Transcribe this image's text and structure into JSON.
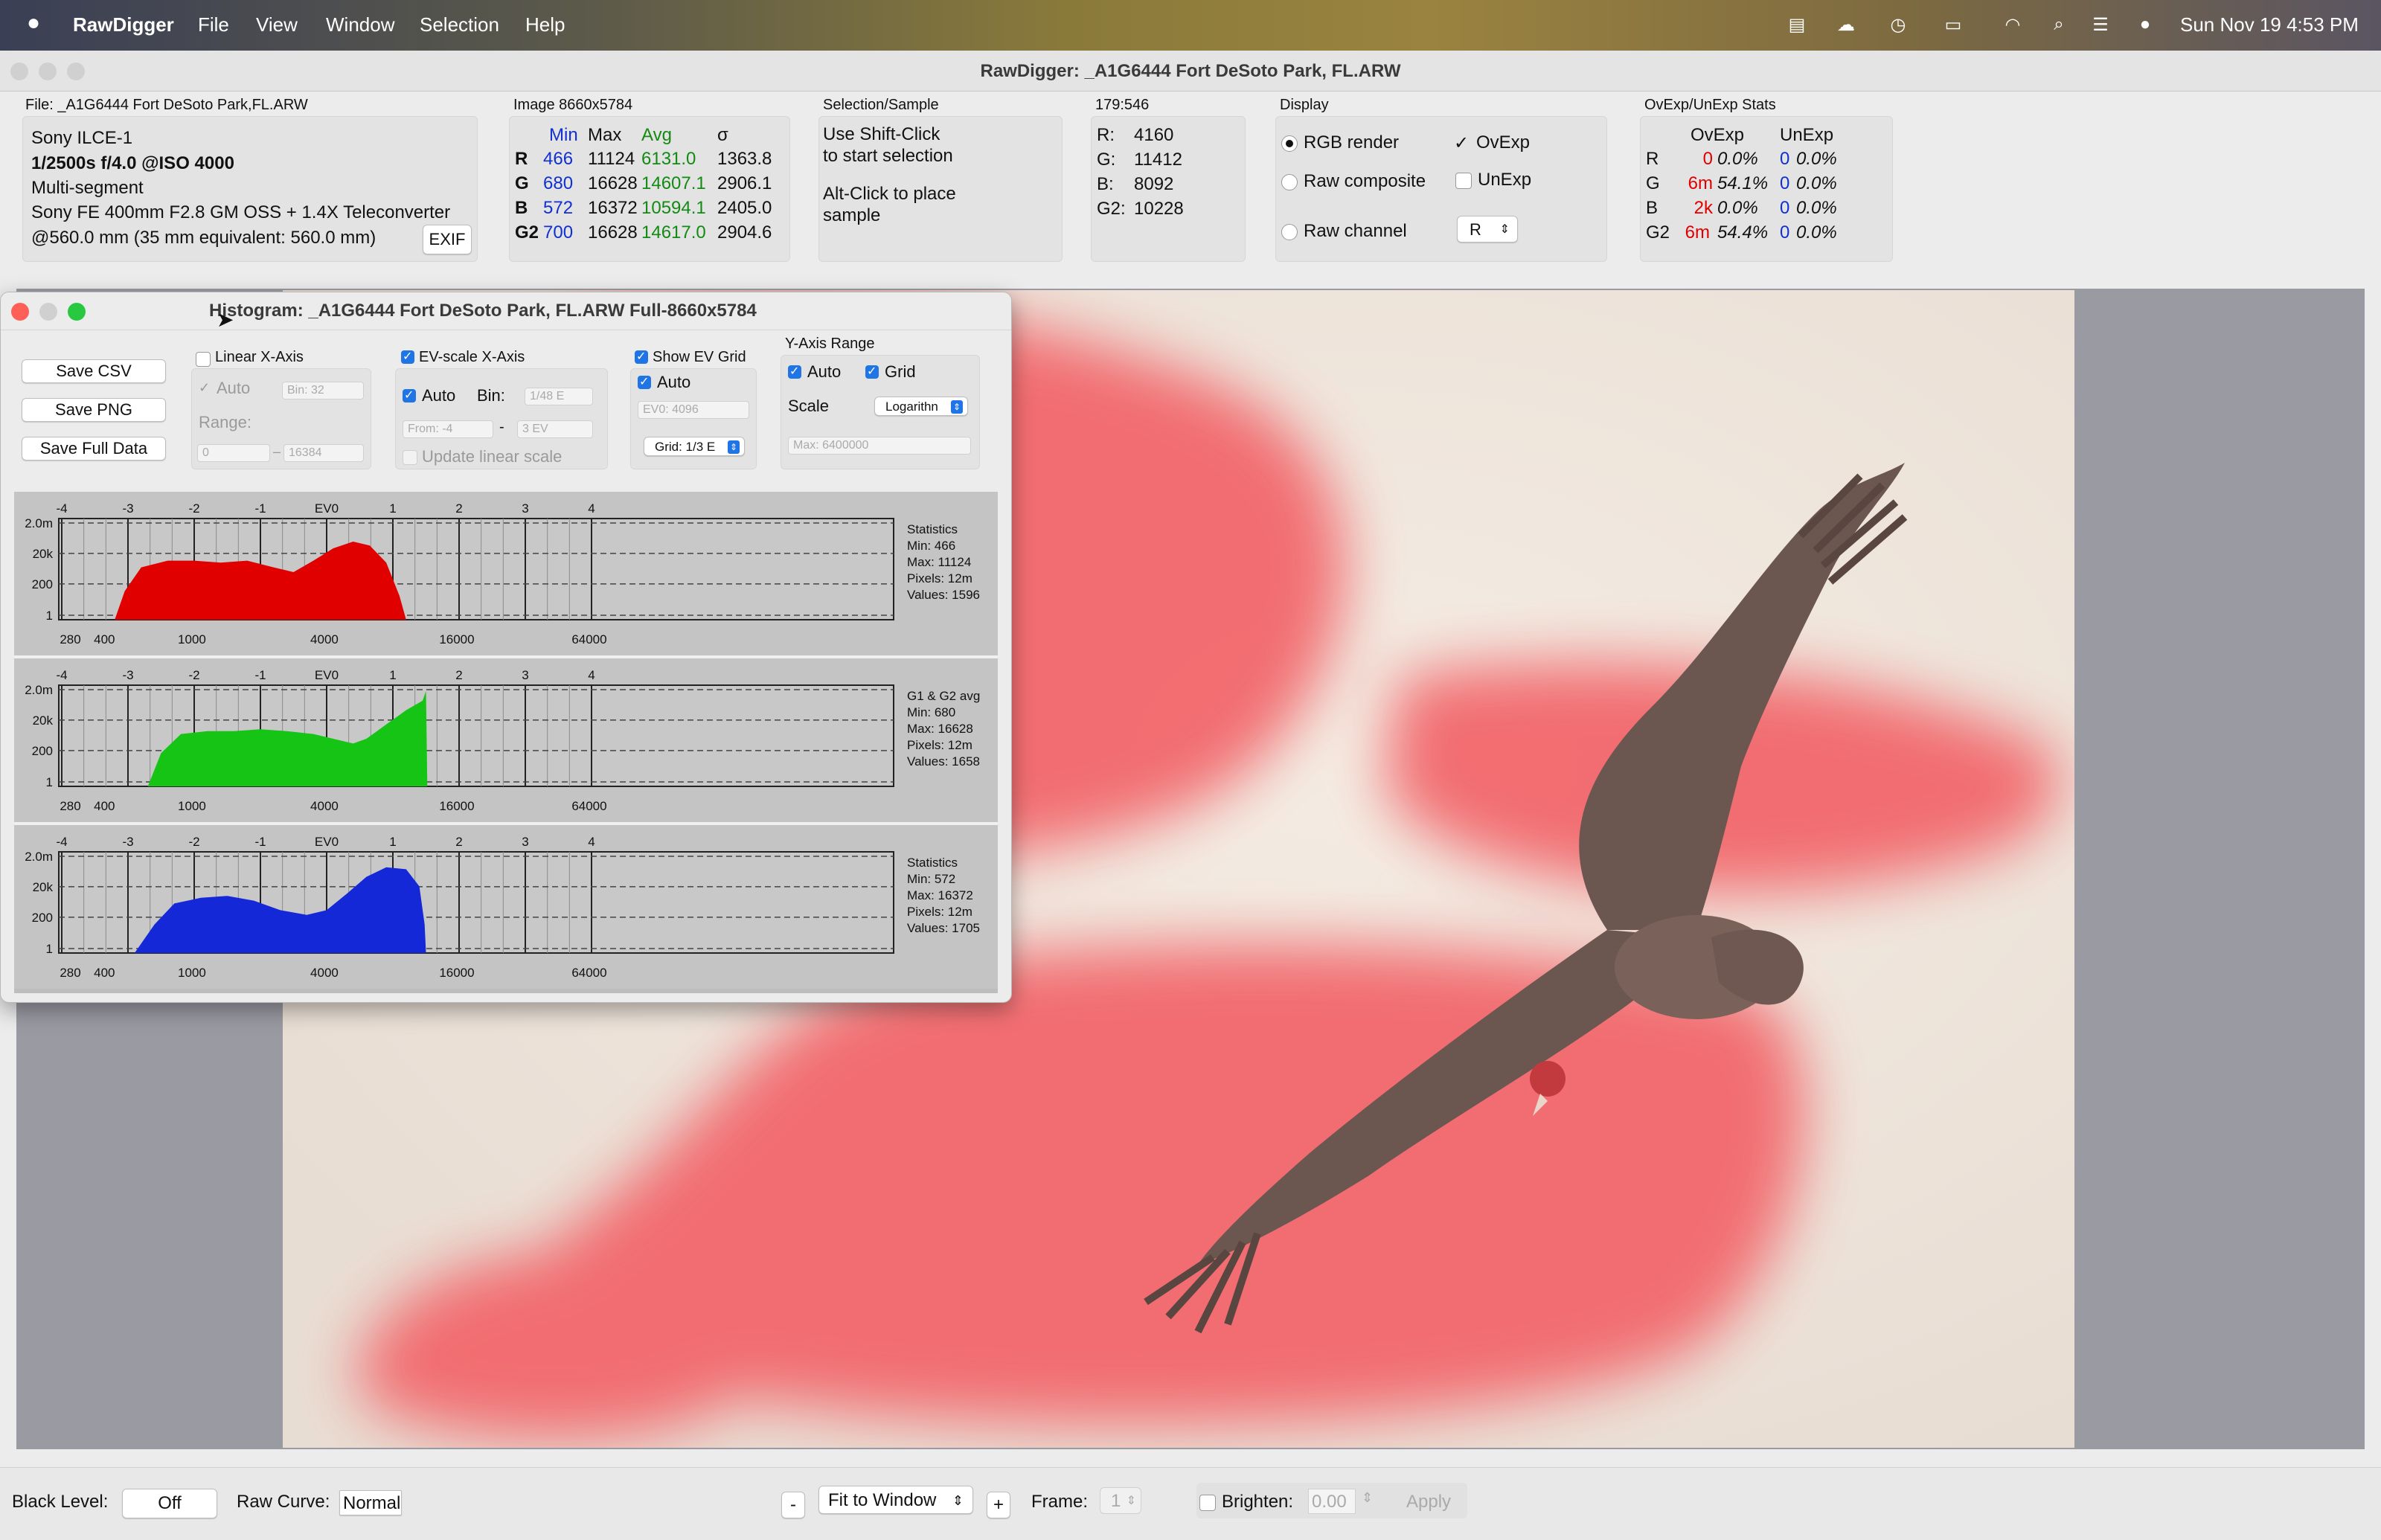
{
  "menubar": {
    "app": "RawDigger",
    "items": [
      "File",
      "View",
      "Window",
      "Selection",
      "Help"
    ],
    "datetime": "Sun Nov 19  4:53 PM"
  },
  "window": {
    "title": "RawDigger: _A1G6444  Fort DeSoto Park, FL.ARW"
  },
  "file_panel": {
    "label": "File: _A1G6444   Fort DeSoto Park,FL.ARW",
    "camera": "Sony ILCE-1",
    "exposure": "1/2500s f/4.0 @ISO 4000",
    "metering": "Multi-segment",
    "lens": "Sony FE 400mm F2.8 GM OSS + 1.4X Teleconverter",
    "focal": "@560.0 mm (35 mm equivalent: 560.0 mm)",
    "exif_button": "EXIF"
  },
  "image_panel": {
    "label": "Image 8660x5784",
    "headers": [
      "Min",
      "Max",
      "Avg",
      "σ"
    ],
    "rows": [
      {
        "ch": "R",
        "min": "466",
        "max": "11124",
        "avg": "6131.0",
        "sd": "1363.8"
      },
      {
        "ch": "G",
        "min": "680",
        "max": "16628",
        "avg": "14607.1",
        "sd": "2906.1"
      },
      {
        "ch": "B",
        "min": "572",
        "max": "16372",
        "avg": "10594.1",
        "sd": "2405.0"
      },
      {
        "ch": "G2",
        "min": "700",
        "max": "16628",
        "avg": "14617.0",
        "sd": "2904.6"
      }
    ]
  },
  "selection_panel": {
    "label": "Selection/Sample",
    "line1": "Use Shift-Click",
    "line2": "to start selection",
    "line3": "Alt-Click to place",
    "line4": "sample"
  },
  "coord_panel": {
    "label": "179:546",
    "rows": [
      {
        "ch": "R:",
        "v": "4160"
      },
      {
        "ch": "G:",
        "v": "11412"
      },
      {
        "ch": "B:",
        "v": "8092"
      },
      {
        "ch": "G2:",
        "v": "10228"
      }
    ]
  },
  "display_panel": {
    "label": "Display",
    "rgb": "RGB render",
    "raw_composite": "Raw composite",
    "raw_channel": "Raw channel",
    "ovexp": "OvExp",
    "unexp": "UnExp",
    "channel_select": "R"
  },
  "stats_panel": {
    "label": "OvExp/UnExp Stats",
    "headers": [
      "OvExp",
      "UnExp"
    ],
    "rows": [
      {
        "ch": "R",
        "ov": "0",
        "ovp": "0.0%",
        "un": "0",
        "unp": "0.0%"
      },
      {
        "ch": "G",
        "ov": "6m",
        "ovp": "54.1%",
        "un": "0",
        "unp": "0.0%"
      },
      {
        "ch": "B",
        "ov": "2k",
        "ovp": "0.0%",
        "un": "0",
        "unp": "0.0%"
      },
      {
        "ch": "G2",
        "ov": "6m",
        "ovp": "54.4%",
        "un": "0",
        "unp": "0.0%"
      }
    ]
  },
  "histogram": {
    "title": "Histogram: _A1G6444   Fort DeSoto Park, FL.ARW Full-8660x5784",
    "buttons": [
      "Save CSV",
      "Save PNG",
      "Save Full Data"
    ],
    "linear": {
      "label": "Linear X-Axis",
      "auto": "Auto",
      "bin": "Bin: 32",
      "range": "Range:",
      "from": "0",
      "to": "16384"
    },
    "ev": {
      "label": "EV-scale X-Axis",
      "auto": "Auto",
      "bin_label": "Bin:",
      "bin": "1/48 E",
      "from": "From: -4",
      "to": "3 EV",
      "update": "Update linear scale"
    },
    "grid": {
      "label": "Show EV Grid",
      "auto": "Auto",
      "ev0": "EV0: 4096",
      "grid": "Grid: 1/3 E"
    },
    "yaxis": {
      "label": "Y-Axis Range",
      "auto": "Auto",
      "grid": "Grid",
      "scale_label": "Scale",
      "scale": "Logarithn",
      "max": "Max: 6400000"
    },
    "ev_ticks": [
      "-4",
      "-3",
      "-2",
      "-1",
      "EV0",
      "1",
      "2",
      "3",
      "4"
    ],
    "y_ticks": [
      "2.0m",
      "20k",
      "200",
      "1"
    ],
    "x_ticks": [
      "280",
      "400",
      "1000",
      "4000",
      "16000",
      "64000"
    ],
    "panels": [
      {
        "color": "#e00000",
        "stats": [
          "Statistics",
          "Min: 466",
          "Max: 11124",
          "Pixels: 12m",
          "Values: 1596"
        ]
      },
      {
        "color": "#16c416",
        "stats": [
          "G1 & G2 avg",
          "Min: 680",
          "Max: 16628",
          "Pixels: 12m",
          "Values: 1658"
        ]
      },
      {
        "color": "#1428d8",
        "stats": [
          "Statistics",
          "Min: 572",
          "Max: 16372",
          "Pixels: 12m",
          "Values: 1705"
        ]
      }
    ]
  },
  "bottombar": {
    "black_level_label": "Black Level:",
    "black_level": "Off",
    "raw_curve_label": "Raw Curve:",
    "raw_curve": "Normal",
    "minus": "-",
    "fit": "Fit to Window",
    "plus": "+",
    "frame_label": "Frame:",
    "frame": "1",
    "brighten_label": "Brighten:",
    "brighten": "0.00",
    "apply": "Apply"
  },
  "colors": {
    "blue_text": "#1030d0",
    "green_text": "#138a13",
    "red_text": "#e00000",
    "overexposure": "#f26a6e"
  }
}
